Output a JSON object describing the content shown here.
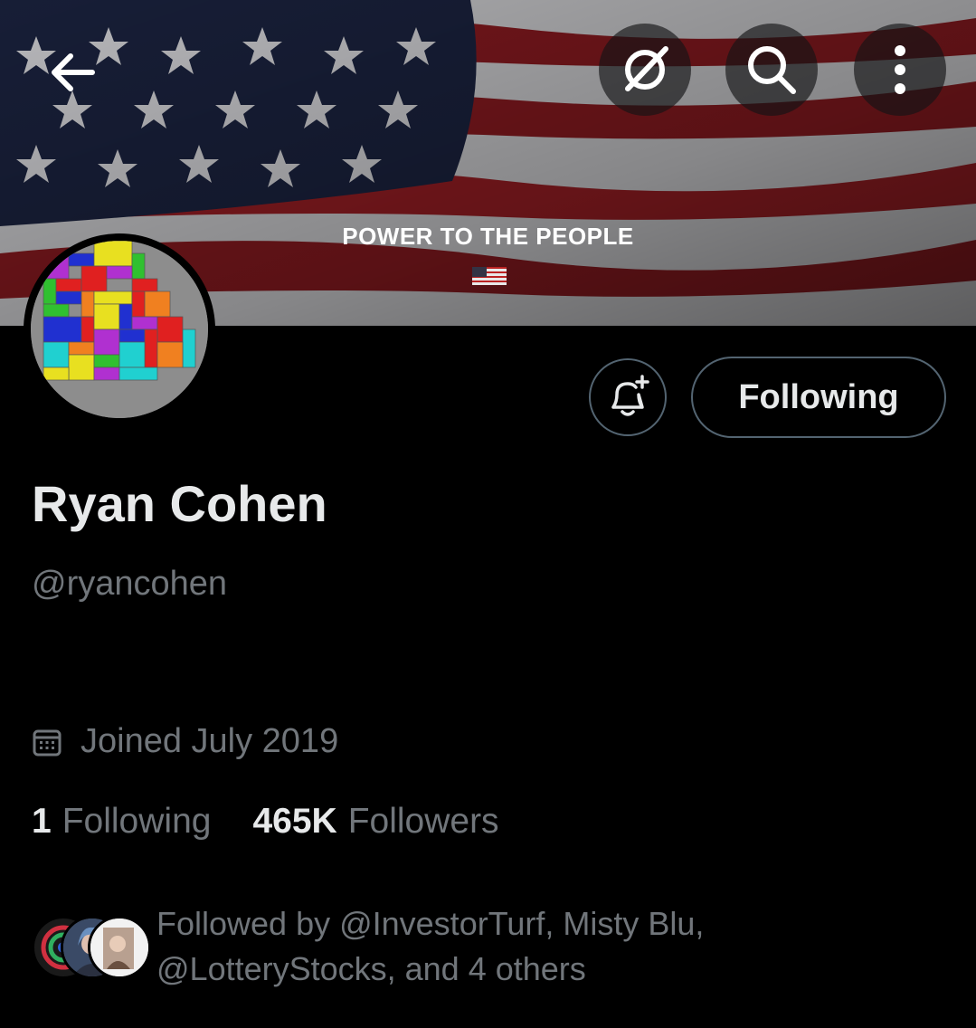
{
  "header": {
    "back_icon": "arrow-left-icon",
    "grok_icon": "grok-icon",
    "search_icon": "search-icon",
    "more_icon": "more-vertical-icon"
  },
  "banner": {
    "text": "POWER TO THE PEOPLE",
    "flag_emoji": "🇺🇸"
  },
  "actions": {
    "notify_icon": "bell-plus-icon",
    "follow_label": "Following"
  },
  "profile": {
    "name": "Ryan Cohen",
    "handle": "@ryancohen",
    "joined": "Joined July 2019",
    "following_count": "1",
    "following_label": "Following",
    "followers_count": "465K",
    "followers_label": "Followers",
    "followed_by_line1": "Followed by @InvestorTurf, Misty Blu,",
    "followed_by_line2": "@LotteryStocks, and 4 others"
  },
  "colors": {
    "background": "#000000",
    "text_primary": "#e7e9ea",
    "text_secondary": "#71767b",
    "border": "#536471"
  }
}
